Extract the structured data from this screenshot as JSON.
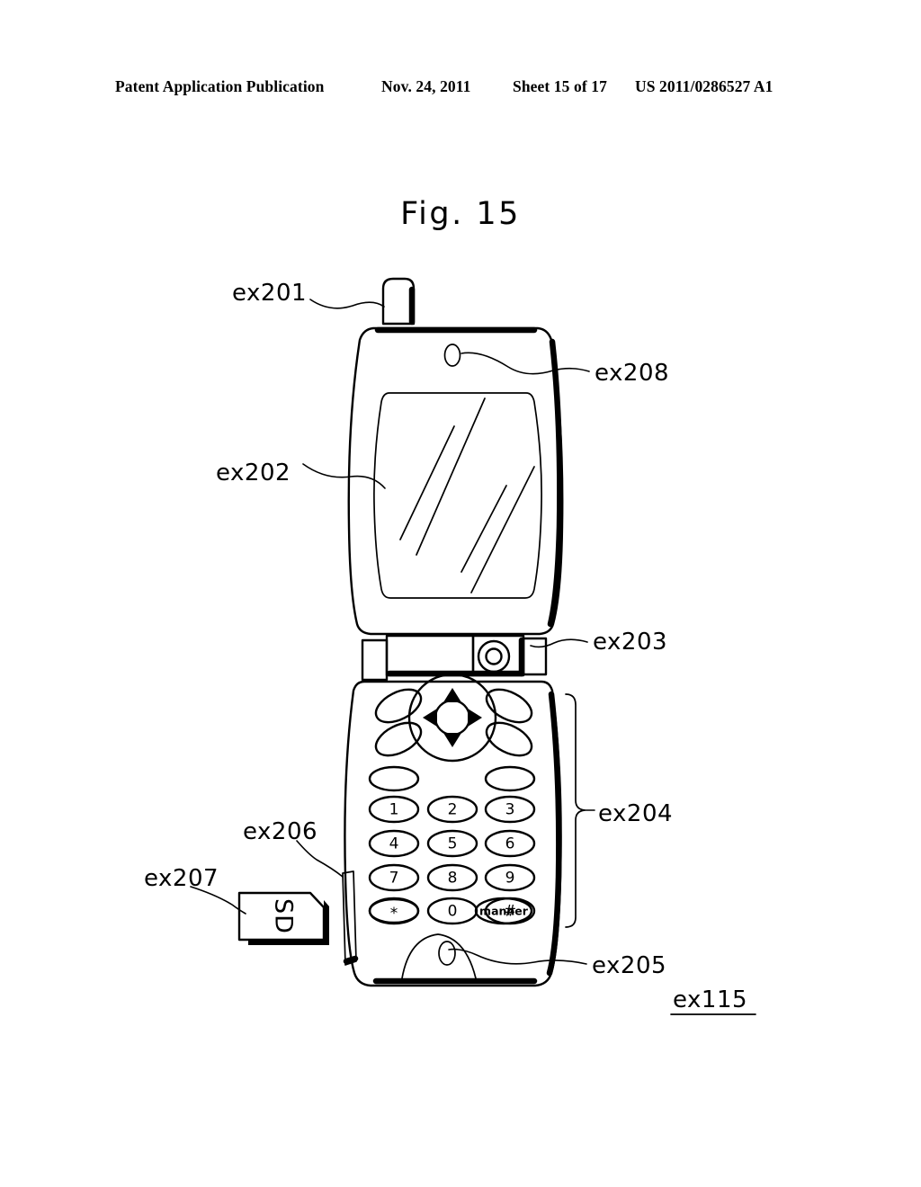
{
  "header": {
    "publication": "Patent Application Publication",
    "date": "Nov. 24, 2011",
    "sheet": "Sheet 15 of 17",
    "number": "US 2011/0286527 A1"
  },
  "figure": {
    "title": "Fig. 15",
    "device_label": "ex115"
  },
  "callouts": {
    "antenna": "ex201",
    "display": "ex202",
    "hinge_camera": "ex203",
    "keypad": "ex204",
    "microphone": "ex205",
    "card_slot": "ex206",
    "memory_card": "ex207",
    "speaker": "ex208"
  },
  "memory_card": {
    "label": "SD"
  },
  "keypad": {
    "rows": [
      [
        "1",
        "2",
        "3"
      ],
      [
        "4",
        "5",
        "6"
      ],
      [
        "7",
        "8",
        "9"
      ],
      [
        "*",
        "0",
        "#"
      ]
    ],
    "manner_key": "manner"
  },
  "colors": {
    "ink": "#000000",
    "paper": "#ffffff"
  }
}
